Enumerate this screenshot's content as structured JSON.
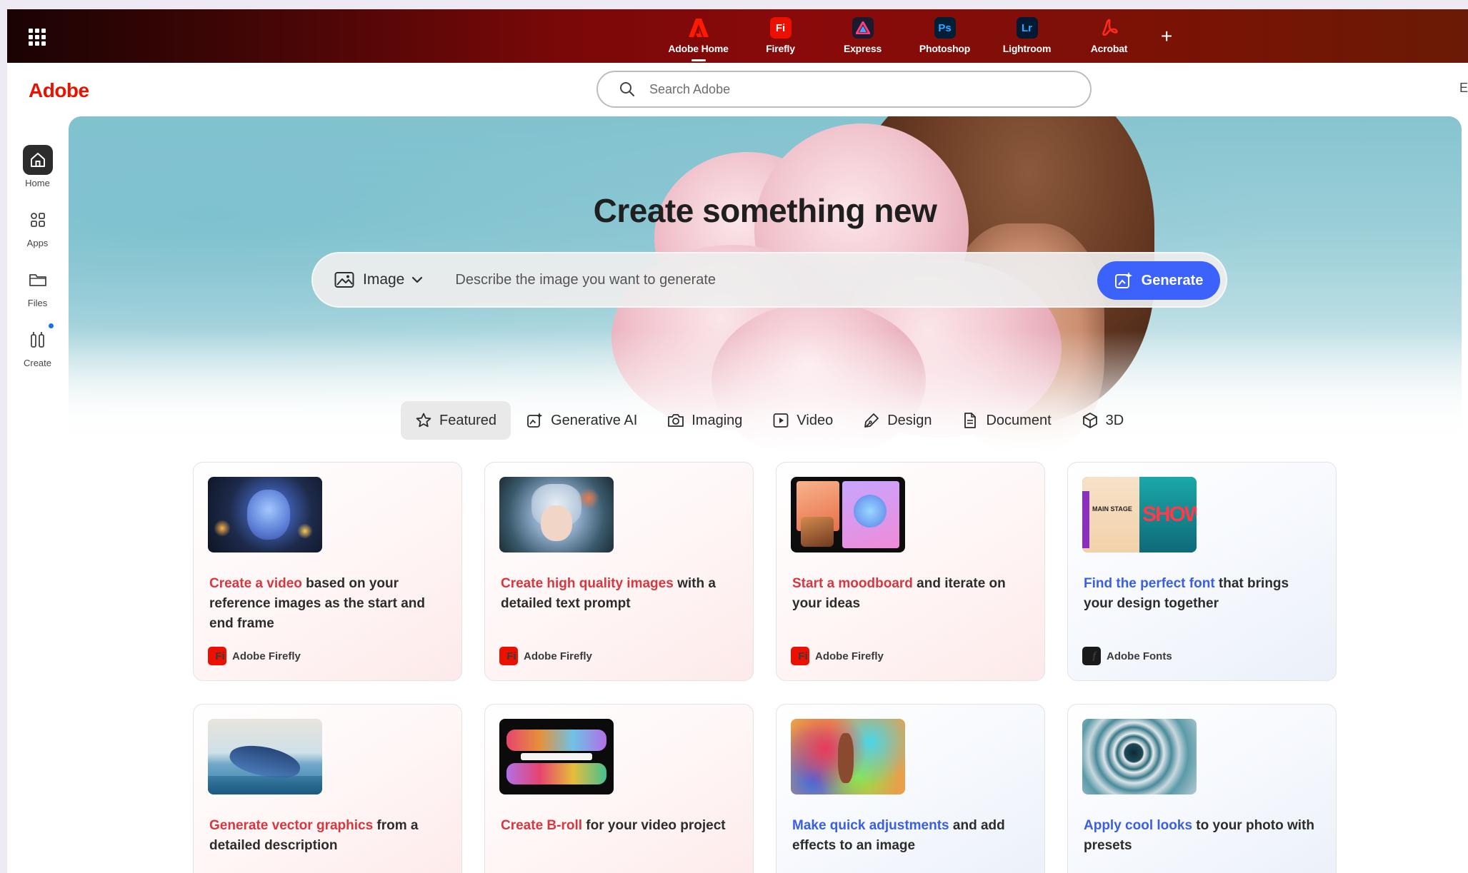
{
  "topbar": {
    "apps": [
      {
        "label": "Adobe Home",
        "icon": "adobe-a-icon",
        "color": "#ff1a00",
        "abbr": ""
      },
      {
        "label": "Firefly",
        "icon": "firefly-icon",
        "color": "#eb1000",
        "abbr": "Fi"
      },
      {
        "label": "Express",
        "icon": "express-icon",
        "color": "#1b1b2f",
        "abbr": "A"
      },
      {
        "label": "Photoshop",
        "icon": "photoshop-icon",
        "color": "#001e36",
        "abbr": "Ps"
      },
      {
        "label": "Lightroom",
        "icon": "lightroom-icon",
        "color": "#001a33",
        "abbr": "Lr"
      },
      {
        "label": "Acrobat",
        "icon": "acrobat-icon",
        "color": "#b30b00",
        "abbr": ""
      }
    ],
    "add_label": "+"
  },
  "header": {
    "logo": "Adobe",
    "search_placeholder": "Search Adobe",
    "edge_text": "E"
  },
  "leftnav": [
    {
      "label": "Home",
      "icon": "home-icon"
    },
    {
      "label": "Apps",
      "icon": "apps-icon"
    },
    {
      "label": "Files",
      "icon": "folder-icon"
    },
    {
      "label": "Create",
      "icon": "create-icon"
    }
  ],
  "hero": {
    "title": "Create something new",
    "type_label": "Image",
    "prompt_placeholder": "Describe the image you want to generate",
    "generate_label": "Generate"
  },
  "tabs": [
    {
      "label": "Featured",
      "icon": "star-icon"
    },
    {
      "label": "Generative AI",
      "icon": "generative-ai-icon"
    },
    {
      "label": "Imaging",
      "icon": "camera-icon"
    },
    {
      "label": "Video",
      "icon": "video-icon"
    },
    {
      "label": "Design",
      "icon": "pen-icon"
    },
    {
      "label": "Document",
      "icon": "document-icon"
    },
    {
      "label": "3D",
      "icon": "cube-icon"
    }
  ],
  "cards": [
    {
      "highlight": "Create a video",
      "rest": " based on your reference images as the start and end frame",
      "product": "Adobe Firefly",
      "product_abbr": "Fi"
    },
    {
      "highlight": "Create high quality images",
      "rest": " with a detailed text prompt",
      "product": "Adobe Firefly",
      "product_abbr": "Fi"
    },
    {
      "highlight": "Start a moodboard",
      "rest": " and iterate on your ideas",
      "product": "Adobe Firefly",
      "product_abbr": "Fi"
    },
    {
      "highlight": "Find the perfect font",
      "rest": " that brings your design together",
      "product": "Adobe Fonts",
      "product_abbr": "f",
      "thumb_text_1": "MAIN STAGE",
      "thumb_text_2": "SHOW"
    },
    {
      "highlight": "Generate vector graphics",
      "rest": " from a detailed description"
    },
    {
      "highlight": "Create B-roll",
      "rest": " for your video project"
    },
    {
      "highlight": "Make quick adjustments",
      "rest": " and add effects to an image"
    },
    {
      "highlight": "Apply cool looks",
      "rest": " to your photo with presets"
    }
  ],
  "colors": {
    "accent_red": "#d7373f",
    "accent_blue": "#3a5fe0",
    "generate_button": "#3b63fb",
    "adobe_red": "#eb1000"
  }
}
